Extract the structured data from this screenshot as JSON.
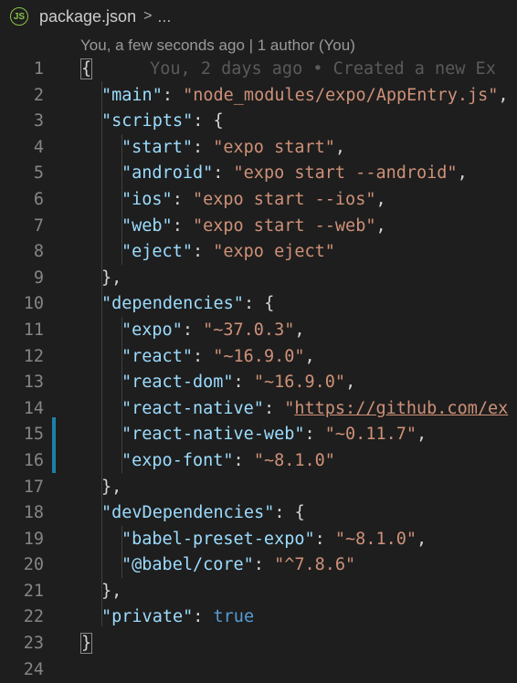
{
  "breadcrumb": {
    "file_icon": "js-icon",
    "file_icon_text": "JS",
    "file_name": "package.json",
    "separator": ">",
    "ellipsis": "..."
  },
  "codelens": "You, a few seconds ago | 1 author (You)",
  "blame_line1": "You, 2 days ago • Created a new Ex",
  "lines": [
    {
      "n": "1"
    },
    {
      "n": "2"
    },
    {
      "n": "3"
    },
    {
      "n": "4"
    },
    {
      "n": "5"
    },
    {
      "n": "6"
    },
    {
      "n": "7"
    },
    {
      "n": "8"
    },
    {
      "n": "9"
    },
    {
      "n": "10"
    },
    {
      "n": "11"
    },
    {
      "n": "12"
    },
    {
      "n": "13"
    },
    {
      "n": "14"
    },
    {
      "n": "15"
    },
    {
      "n": "16"
    },
    {
      "n": "17"
    },
    {
      "n": "18"
    },
    {
      "n": "19"
    },
    {
      "n": "20"
    },
    {
      "n": "21"
    },
    {
      "n": "22"
    },
    {
      "n": "23"
    },
    {
      "n": "24"
    }
  ],
  "code": {
    "open_brace": "{",
    "main_key": "\"main\"",
    "main_val": "\"node_modules/expo/AppEntry.js\"",
    "scripts_key": "\"scripts\"",
    "start_key": "\"start\"",
    "start_val": "\"expo start\"",
    "android_key": "\"android\"",
    "android_val": "\"expo start --android\"",
    "ios_key": "\"ios\"",
    "ios_val": "\"expo start --ios\"",
    "web_key": "\"web\"",
    "web_val": "\"expo start --web\"",
    "eject_key": "\"eject\"",
    "eject_val": "\"expo eject\"",
    "deps_key": "\"dependencies\"",
    "expo_key": "\"expo\"",
    "expo_val": "\"~37.0.3\"",
    "react_key": "\"react\"",
    "react_val": "\"~16.9.0\"",
    "reactdom_key": "\"react-dom\"",
    "reactdom_val": "\"~16.9.0\"",
    "rn_key": "\"react-native\"",
    "rn_quote": "\"",
    "rn_url": "https://github.com/ex",
    "rnw_key": "\"react-native-web\"",
    "rnw_val": "\"~0.11.7\"",
    "ef_key": "\"expo-font\"",
    "ef_val": "\"~8.1.0\"",
    "devdeps_key": "\"devDependencies\"",
    "bpe_key": "\"babel-preset-expo\"",
    "bpe_val": "\"~8.1.0\"",
    "bc_key": "\"@babel/core\"",
    "bc_val": "\"^7.8.6\"",
    "private_key": "\"private\"",
    "private_val": "true",
    "close_brace": "}"
  }
}
